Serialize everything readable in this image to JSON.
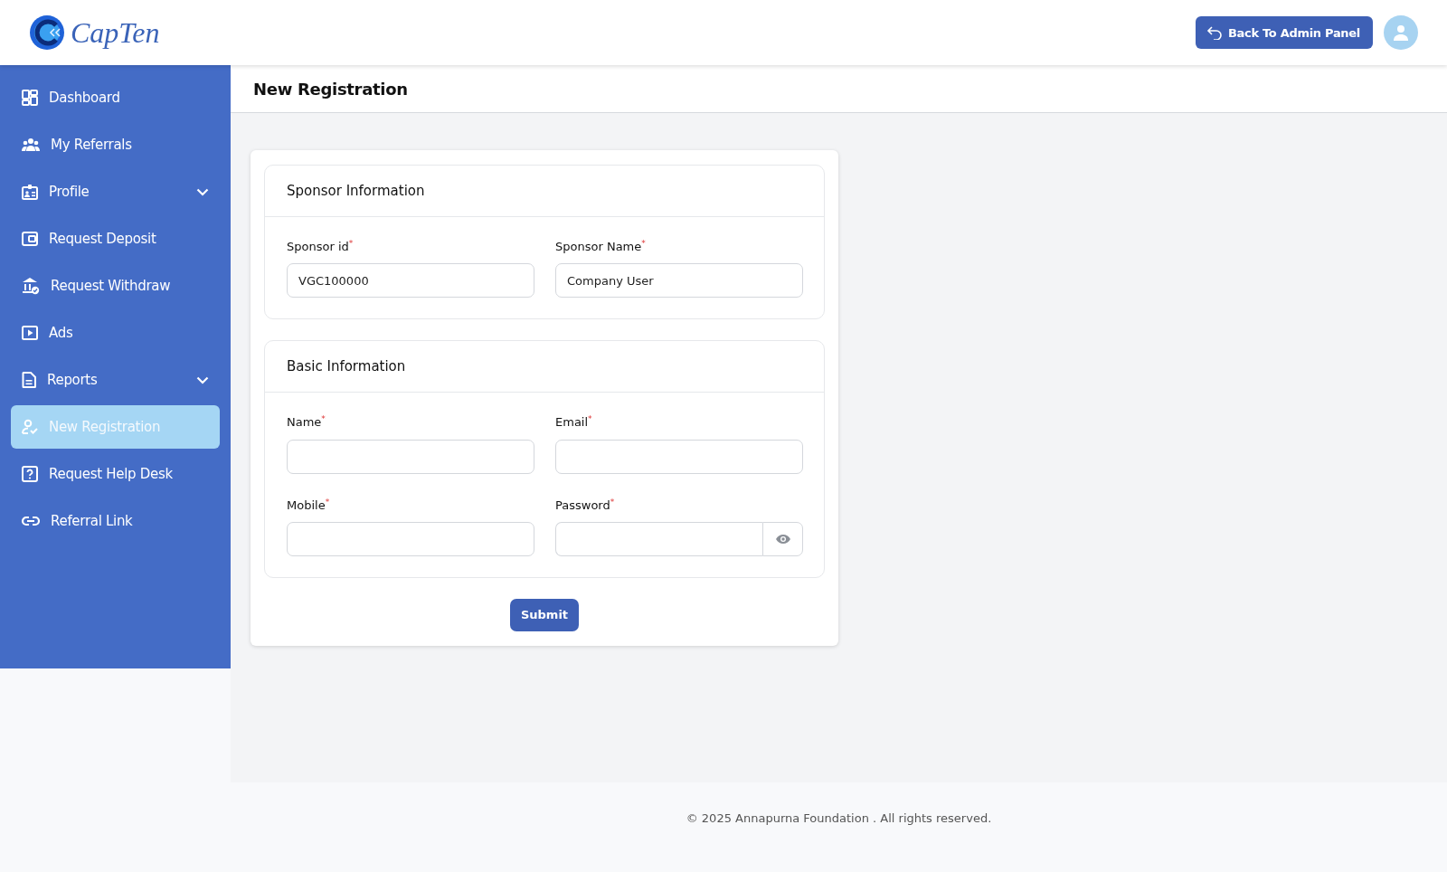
{
  "header": {
    "logo_text": "CapTen",
    "back_button": "Back To Admin Panel"
  },
  "sidebar": {
    "items": [
      {
        "label": "Dashboard",
        "expandable": false,
        "selected": false
      },
      {
        "label": "My Referrals",
        "expandable": false,
        "selected": false
      },
      {
        "label": "Profile",
        "expandable": true,
        "selected": false
      },
      {
        "label": "Request Deposit",
        "expandable": false,
        "selected": false
      },
      {
        "label": "Request Withdraw",
        "expandable": false,
        "selected": false
      },
      {
        "label": "Ads",
        "expandable": false,
        "selected": false
      },
      {
        "label": "Reports",
        "expandable": true,
        "selected": false
      },
      {
        "label": "New Registration",
        "expandable": false,
        "selected": true
      },
      {
        "label": "Request Help Desk",
        "expandable": false,
        "selected": false
      },
      {
        "label": "Referral Link",
        "expandable": false,
        "selected": false
      }
    ]
  },
  "page_title": "New Registration",
  "sections": [
    {
      "title": "Sponsor Information",
      "fields": [
        {
          "label": "Sponsor id$^{*}$",
          "value": "VGC100000",
          "kind": "text"
        },
        {
          "label": "Sponsor Name$^{*}$",
          "value": "Company User",
          "kind": "text"
        }
      ]
    },
    {
      "title": "Basic Information",
      "fields": [
        {
          "label": "Name$^{*}$",
          "kind": "text"
        },
        {
          "label": "Email$^{*}$",
          "kind": "text"
        },
        {
          "label": "Mobile$^{*}$",
          "kind": "text"
        },
        {
          "label": "Password$^{*}$",
          "kind": "password"
        }
      ]
    }
  ],
  "submit_button": "Submit",
  "footer": "© 2025 Annapurna Foundation . All rights reserved."
}
